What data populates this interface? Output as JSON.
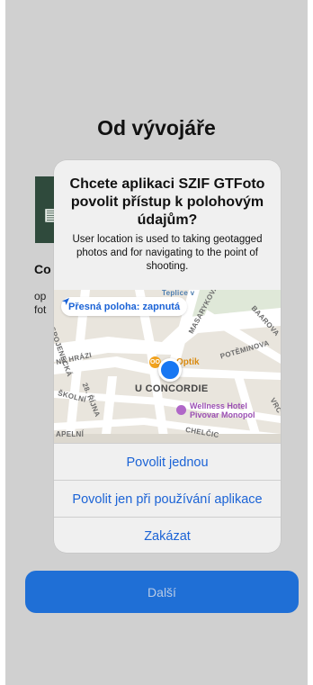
{
  "background": {
    "title": "Od vývojáře",
    "app_name_partial": "Co",
    "app_desc_partial_line1": "op",
    "app_desc_partial_line2": "fot",
    "next_button_label": "Další"
  },
  "dialog": {
    "title": "Chcete aplikaci SZIF GTFoto povolit přístup k polohovým údajům?",
    "message": "User location is used to taking geotagged photos and for navigating to the point of shooting.",
    "precise_location_label": "Přesná poloha: zapnutá",
    "map_labels": {
      "teplice": "Teplice v",
      "spojeneckа": "SPOJENECKÁ",
      "na_hrazi": "NA HRÁZI",
      "masarykova": "MASARYKOVA TŘ.",
      "baarova": "BAAROVA",
      "potěminova": "POTĚMINOVA",
      "u_concordie": "U CONCORDIE",
      "rijna": "28. ŘÍJNA",
      "skolni": "ŠKOLNÍ",
      "chelcic": "CHELČIC",
      "apelni": "APELNÍ",
      "vrc": "VRC"
    },
    "poi_optik": "Optik",
    "poi_optik_badge": "OO",
    "poi_hotel_line1": "Wellness Hotel",
    "poi_hotel_line2": "Pivovar Monopol",
    "actions": {
      "allow_once": "Povolit jednou",
      "allow_while_using": "Povolit jen při používání aplikace",
      "deny": "Zakázat"
    }
  },
  "colors": {
    "accent": "#1b63d6",
    "next_button": "#1f6fd6",
    "dialog_bg": "#f0f0f0",
    "screen_dim": "#d0d0d0"
  }
}
